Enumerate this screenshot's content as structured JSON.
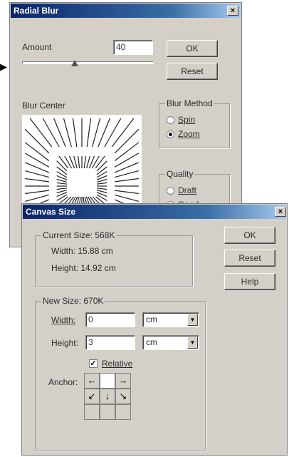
{
  "radial_blur": {
    "title": "Radial Blur",
    "close": "×",
    "amount_label": "Amount",
    "amount_value": "40",
    "amount_fraction": 0.4,
    "ok": "OK",
    "reset": "Reset",
    "blur_center_label": "Blur Center",
    "blur_method": {
      "label": "Blur Method",
      "options": [
        "Spin",
        "Zoom"
      ],
      "selected": "Zoom"
    },
    "quality": {
      "label": "Quality",
      "options": [
        "Draft",
        "Good"
      ],
      "selected": "Good"
    }
  },
  "canvas_size": {
    "title": "Canvas Size",
    "close": "×",
    "current_size": {
      "label": "Current Size: 568K",
      "width": "Width: 15.88 cm",
      "height": "Height: 14.92 cm"
    },
    "new_size": {
      "label": "New Size: 670K",
      "width_label": "Width:",
      "width_value": "0",
      "width_unit": "cm",
      "height_label": "Height:",
      "height_value": "3",
      "height_unit": "cm",
      "relative_label": "Relative",
      "relative_checked": true,
      "anchor_label": "Anchor:",
      "anchor_arrows": [
        "←",
        "",
        "→",
        "↙",
        "↓",
        "↘",
        "",
        "",
        ""
      ]
    },
    "ok": "OK",
    "reset": "Reset",
    "help": "Help"
  },
  "pointer": "▶"
}
